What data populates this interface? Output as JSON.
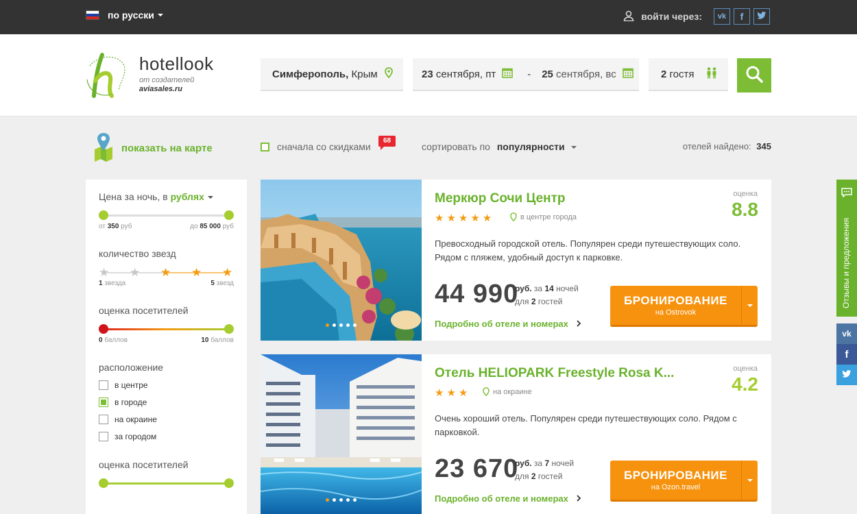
{
  "topbar": {
    "language": "по русски",
    "login_label": "войти через:",
    "social": [
      "vk",
      "f",
      "t"
    ]
  },
  "header": {
    "logo_name": "hotellook",
    "logo_sub1": "от создателей",
    "logo_sub2": "aviasales.ru",
    "city_bold": "Симферополь,",
    "city_region": " Крым",
    "date_from_day": "23",
    "date_from_rest": " сентября, пт",
    "date_sep": "-",
    "date_to_day": "25",
    "date_to_rest": " сентября, вс",
    "guests_count": "2",
    "guests_label": " гостя"
  },
  "filters": {
    "map_label": "показать на карте",
    "discount_label": "сначала со скидками",
    "discount_badge": "68",
    "sort_label": "сортировать по",
    "sort_value": "популярности",
    "found_label": "отелей найдено:",
    "found_count": "345"
  },
  "sidebar": {
    "price_title": "Цена за ночь, в ",
    "price_currency": "рублях",
    "price_from_pre": "от ",
    "price_from": "350",
    "price_from_unit": " руб",
    "price_to_pre": "до ",
    "price_to": "85 000",
    "price_to_unit": " руб",
    "stars_title": "количество звезд",
    "stars_min": "1",
    "stars_min_label": " звезда",
    "stars_max": "5",
    "stars_max_label": " звезд",
    "rating_title": "оценка посетителей",
    "rating_min": "0",
    "rating_min_label": " баллов",
    "rating_max": "10",
    "rating_max_label": " баллов",
    "location_title": "расположение",
    "locations": [
      {
        "label": "в центре",
        "checked": false
      },
      {
        "label": "в городе",
        "checked": true
      },
      {
        "label": "на окраине",
        "checked": false
      },
      {
        "label": "за городом",
        "checked": false
      }
    ],
    "rating2_title": "оценка посетителей"
  },
  "hotels": [
    {
      "name": "Меркюр Сочи Центр",
      "stars": "★★★★★",
      "location": "в центре города",
      "rating_label": "оценка",
      "rating": "8.8",
      "rating_color": "#7cbd35",
      "description": "Превосходный городской отель. Популярен среди путешествующих соло. Рядом с пляжем, удобный доступ к парковке.",
      "price": "44 990",
      "currency": "руб.",
      "nights_pre": " за ",
      "nights": "14",
      "nights_label": " ночей",
      "guests_pre": "для ",
      "guests": "2",
      "guests_label": " гостей",
      "more": "Подробно об отеле и номерах",
      "book": "БРОНИРОВАНИЕ",
      "provider": "на Ostrovok"
    },
    {
      "name": "Отель HELIOPARK Freestyle Rosa K...",
      "stars": "★★★",
      "location": "на окраине",
      "rating_label": "оценка",
      "rating": "4.2",
      "rating_color": "#a5cd2f",
      "description": "Очень хороший отель. Популярен среди путешествующих соло. Рядом с парковкой.",
      "price": "23 670",
      "currency": "руб.",
      "nights_pre": " за ",
      "nights": "7",
      "nights_label": " ночей",
      "guests_pre": "для ",
      "guests": "2",
      "guests_label": " гостей",
      "more": "Подробно об отеле и номерах",
      "book": "БРОНИРОВАНИЕ",
      "provider": "на Ozon.travel"
    }
  ],
  "right": {
    "feedback": "Отзывы и предложения",
    "social": [
      "vk",
      "f",
      "t"
    ]
  },
  "colors": {
    "brand_green": "#7cbd35",
    "book_orange": "#f7920e",
    "topbar": "#333333"
  }
}
